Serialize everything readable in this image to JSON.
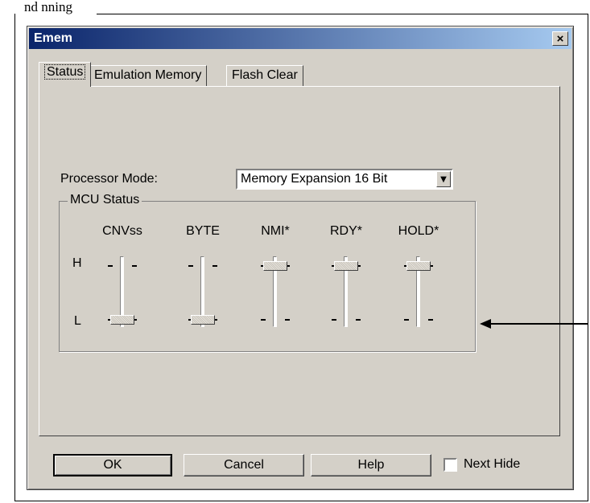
{
  "doc_fragment": "nd nning",
  "dialog": {
    "title": "Emem",
    "close_glyph": "×"
  },
  "tabs": [
    {
      "label": "Status",
      "active": true
    },
    {
      "label": "Emulation Memory",
      "active": false
    },
    {
      "label": "Flash Clear",
      "active": false
    }
  ],
  "processor_mode": {
    "label": "Processor Mode:",
    "value": "Memory Expansion 16 Bit"
  },
  "mcu_status": {
    "title": "MCU Status",
    "high_label": "H",
    "low_label": "L",
    "sliders": [
      {
        "name": "CNVss",
        "state": "L"
      },
      {
        "name": "BYTE",
        "state": "L"
      },
      {
        "name": "NMI*",
        "state": "H"
      },
      {
        "name": "RDY*",
        "state": "H"
      },
      {
        "name": "HOLD*",
        "state": "H"
      }
    ]
  },
  "buttons": {
    "ok": "OK",
    "cancel": "Cancel",
    "help": "Help"
  },
  "next_hide": {
    "label": "Next Hide",
    "checked": false
  }
}
